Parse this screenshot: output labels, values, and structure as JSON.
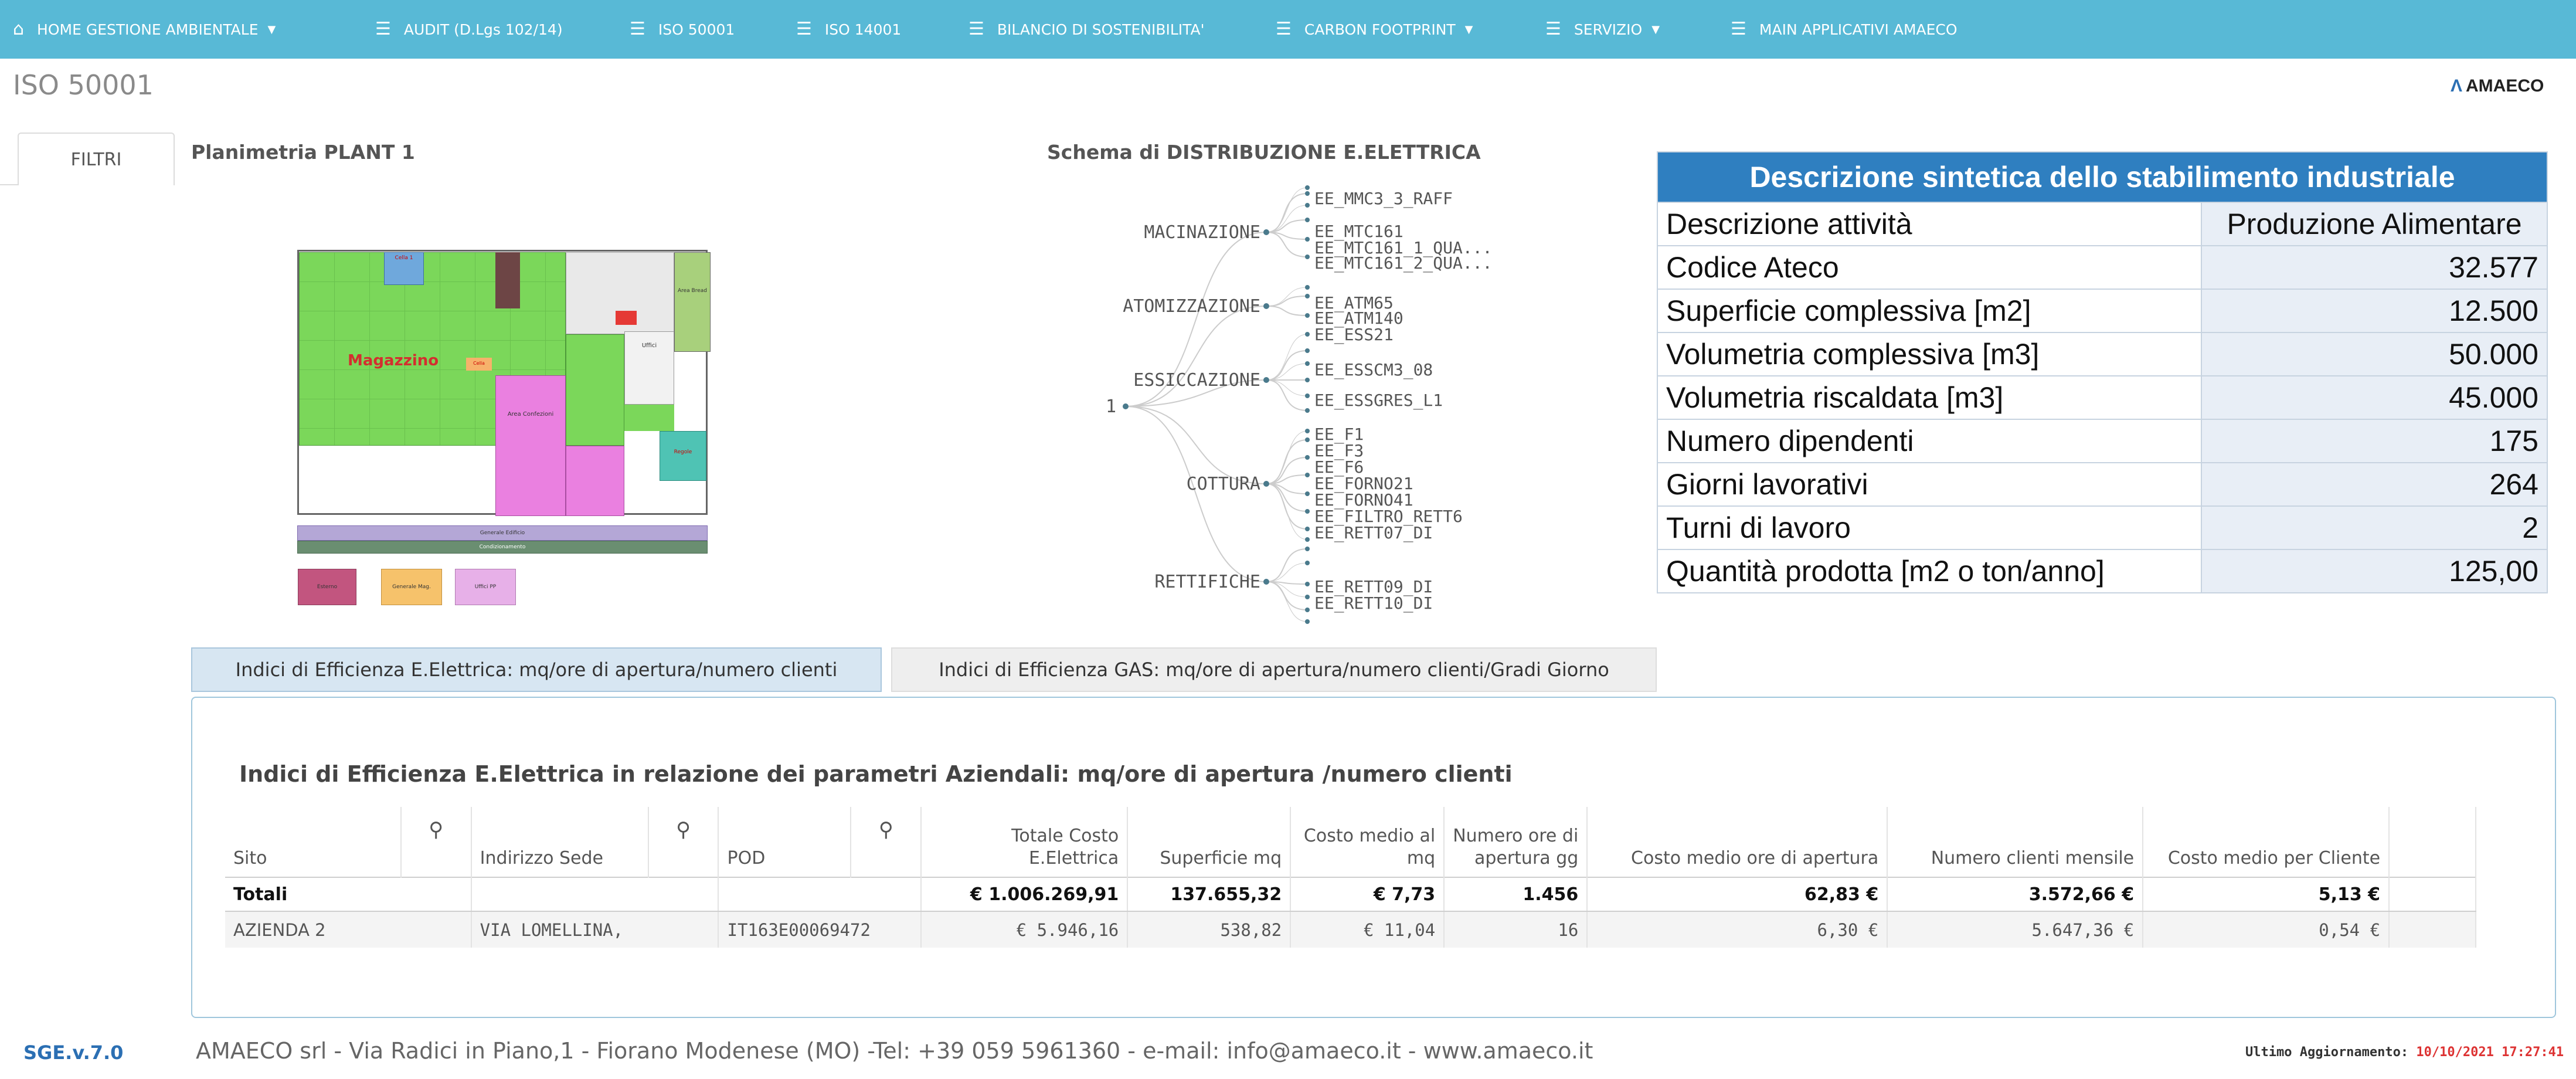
{
  "nav": {
    "items": [
      {
        "label": "HOME GESTIONE AMBIENTALE",
        "icon": "home-icon",
        "caret": true
      },
      {
        "label": "AUDIT (D.Lgs 102/14)",
        "icon": "menu-icon",
        "caret": false
      },
      {
        "label": "ISO 50001",
        "icon": "menu-icon",
        "caret": false
      },
      {
        "label": "ISO 14001",
        "icon": "menu-icon",
        "caret": false
      },
      {
        "label": "BILANCIO DI SOSTENIBILITA'",
        "icon": "menu-icon",
        "caret": false
      },
      {
        "label": "CARBON FOOTPRINT",
        "icon": "menu-icon",
        "caret": true
      },
      {
        "label": "SERVIZIO",
        "icon": "menu-icon",
        "caret": true
      },
      {
        "label": "MAIN APPLICATIVI AMAECO",
        "icon": "menu-icon",
        "caret": false
      }
    ]
  },
  "page": {
    "title": "ISO 50001",
    "logo": "AMAECO"
  },
  "filtri": {
    "label": "FILTRI"
  },
  "plan": {
    "title": "Planimetria PLANT 1",
    "label_magazzino": "Magazzino",
    "label_cella1": "Cella 1",
    "label_area_bread": "Area Bread",
    "label_uffici": "Uffici",
    "label_area_confezioni": "Area Confezioni",
    "label_regole": "Regole",
    "label_cella": "Cella",
    "band_generale": "Generale Edificio",
    "band_condiz": "Condizionamento",
    "legend": [
      "Esterno",
      "Generale Mag.",
      "Uffici PP"
    ]
  },
  "tree": {
    "title": "Schema di DISTRIBUZIONE E.ELETTRICA",
    "root": "1",
    "groups": [
      {
        "name": "MACINAZIONE",
        "leaves": [
          "EE_MMC3_3_RAFF",
          "EE_MTC161",
          "EE_MTC161_1_QUA...",
          "EE_MTC161_2_QUA..."
        ]
      },
      {
        "name": "ATOMIZZAZIONE",
        "leaves": [
          "EE_ATM65",
          "EE_ATM140"
        ]
      },
      {
        "name": "ESSICCAZIONE",
        "leaves": [
          "EE_ESS21",
          "EE_ESSCM3_08",
          "EE_ESSGRES_L1"
        ]
      },
      {
        "name": "COTTURA",
        "leaves": [
          "EE_F1",
          "EE_F3",
          "EE_F6",
          "EE_FORNO21",
          "EE_FORNO41",
          "EE_FILTRO_RETT6"
        ]
      },
      {
        "name": "RETTIFICHE",
        "leaves": [
          "EE_RETT07_DI",
          "EE_RETT09_DI",
          "EE_RETT10_DI"
        ]
      }
    ]
  },
  "info": {
    "title": "Descrizione sintetica dello stabilimento industriale",
    "rows": [
      {
        "label": "Descrizione attività",
        "value": "Produzione Alimentare"
      },
      {
        "label": "Codice Ateco",
        "value": "32.577"
      },
      {
        "label": "Superficie complessiva [m2]",
        "value": "12.500"
      },
      {
        "label": "Volumetria complessiva [m3]",
        "value": "50.000"
      },
      {
        "label": "Volumetria riscaldata [m3]",
        "value": "45.000"
      },
      {
        "label": "Numero dipendenti",
        "value": "175"
      },
      {
        "label": "Giorni lavorativi",
        "value": "264"
      },
      {
        "label": "Turni di lavoro",
        "value": "2"
      },
      {
        "label": "Quantità prodotta [m2 o ton/anno]",
        "value": "125,00"
      }
    ]
  },
  "tabs": [
    {
      "label": "Indici di Efficienza E.Elettrica: mq/ore di apertura/numero clienti",
      "active": true
    },
    {
      "label": "Indici di Efficienza GAS: mq/ore di apertura/numero clienti/Gradi Giorno",
      "active": false
    }
  ],
  "grid": {
    "title": "Indici di Efficienza E.Elettrica in relazione dei parametri Aziendali: mq/ore di apertura /numero clienti",
    "headers": {
      "sito": "Sito",
      "indirizzo": "Indirizzo Sede",
      "pod": "POD",
      "totale_costo": [
        "Totale Costo",
        "E.Elettrica"
      ],
      "superficie": "Superficie mq",
      "costo_medio_mq": [
        "Costo medio al",
        "mq"
      ],
      "ore_apertura": [
        "Numero ore di",
        "apertura gg"
      ],
      "costo_ore": "Costo medio ore di apertura",
      "clienti": "Numero clienti mensile",
      "costo_cliente": "Costo medio per Cliente"
    },
    "totals": {
      "label": "Totali",
      "totale_costo": "€ 1.006.269,91",
      "superficie": "137.655,32",
      "costo_medio_mq": "€ 7,73",
      "ore_apertura": "1.456",
      "costo_ore": "62,83 €",
      "clienti": "3.572,66 €",
      "costo_cliente": "5,13 €"
    },
    "rows": [
      {
        "sito": "AZIENDA 2",
        "indirizzo": "VIA LOMELLINA,",
        "pod": "IT163E00069472",
        "totale_costo": "€ 5.946,16",
        "superficie": "538,82",
        "costo_medio_mq": "€ 11,04",
        "ore_apertura": "16",
        "costo_ore": "6,30 €",
        "clienti": "5.647,36 €",
        "costo_cliente": "0,54 €"
      }
    ]
  },
  "footer": {
    "version": "SGE.v.7.0",
    "company": "AMAECO srl - Via Radici in Piano,1 - Fiorano Modenese (MO) -Tel: +39 059 5961360 - e-mail: info@amaeco.it - www.amaeco.it",
    "updated_label": "Ultimo Aggiornamento:",
    "updated_value": "10/10/2021 17:27:41"
  }
}
